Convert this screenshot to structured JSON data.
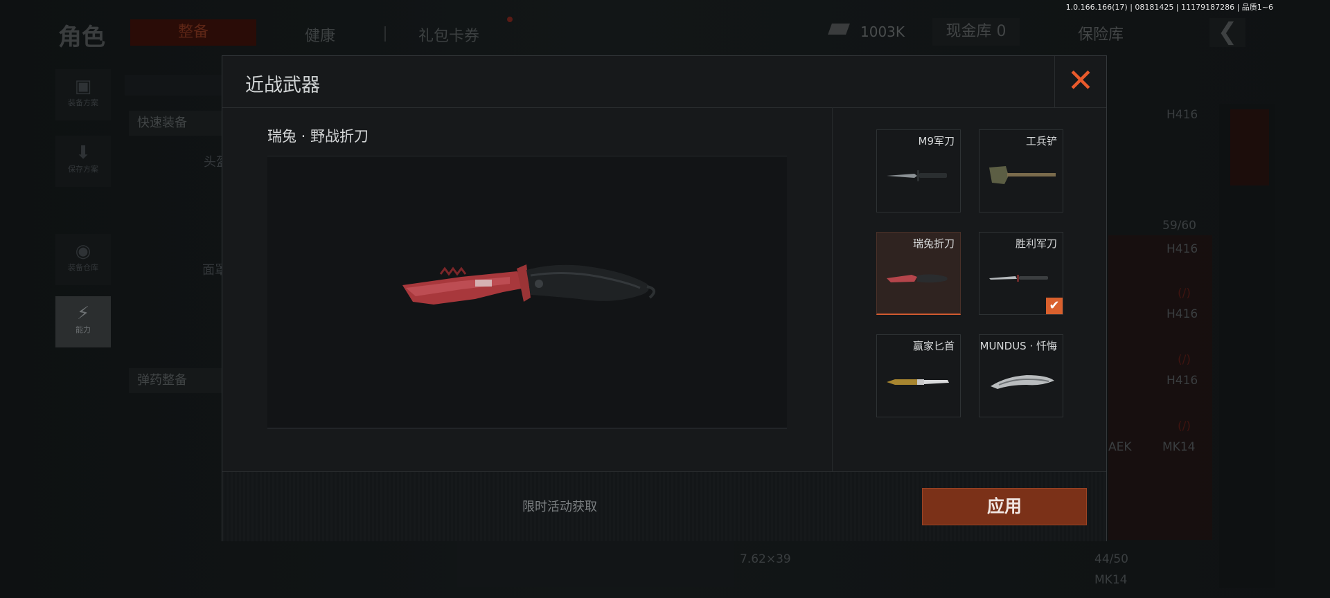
{
  "version_info": "1.0.166.166(17) | 08181425 | 11179187286 | 品质1~6",
  "background": {
    "title": "角色",
    "tabs": [
      "整备",
      "健康",
      "礼包卡券"
    ],
    "money": "1003K",
    "vault": "现金库 0",
    "safe": "保险库",
    "quick_equip": "快速装备",
    "ammo_equip": "弹药整备",
    "sidebar": [
      "装备方案",
      "保存方案",
      "装备仓库",
      "能力"
    ],
    "left_labels": [
      "头盔",
      "面罩"
    ],
    "list": [
      "H416",
      "59/60",
      "H416",
      "(/)",
      "H416",
      "(/)",
      "H416",
      "(/)",
      "AEK",
      "MK14",
      "7.62×39",
      "44/50",
      "MK14"
    ]
  },
  "dialog": {
    "title": "近战武器",
    "selected_name": "瑞兔 · 野战折刀",
    "items": [
      {
        "label": "M9军刀",
        "icon": "bayonet-icon"
      },
      {
        "label": "工兵铲",
        "icon": "shovel-icon"
      },
      {
        "label": "瑞兔折刀",
        "icon": "red-knife-icon"
      },
      {
        "label": "胜利军刀",
        "icon": "dagger-icon"
      },
      {
        "label": "赢家匕首",
        "icon": "gold-dagger-icon"
      },
      {
        "label": "MUNDUS · 忏悔",
        "icon": "ornate-knife-icon"
      }
    ],
    "selected_index": 2,
    "equipped_index": 3,
    "footer_note": "限时活动获取",
    "apply_label": "应用",
    "close_icon": "close-icon",
    "accent": "#d9602d"
  }
}
